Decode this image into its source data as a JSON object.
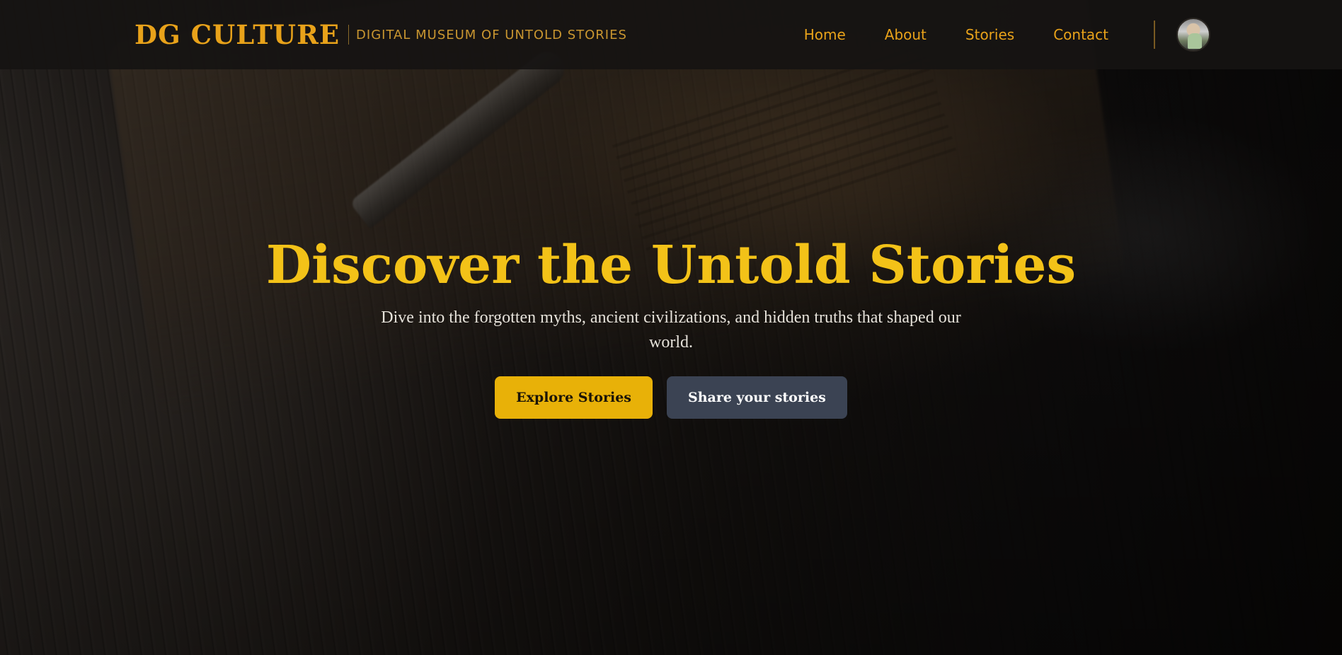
{
  "header": {
    "logo": "DG CULTURE",
    "tagline": "DIGITAL MUSEUM OF UNTOLD STORIES",
    "nav": [
      {
        "label": "Home"
      },
      {
        "label": "About"
      },
      {
        "label": "Stories"
      },
      {
        "label": "Contact"
      }
    ],
    "avatar_alt": "User avatar"
  },
  "hero": {
    "title": "Discover the Untold Stories",
    "subtitle": "Dive into the forgotten myths, ancient civilizations, and hidden truths that shaped our world.",
    "primary_cta": "Explore Stories",
    "secondary_cta": "Share your stories",
    "background": "old-book-and-fountain-pen-on-wooden-table"
  },
  "colors": {
    "accent": "#e8a21a",
    "title": "#f3c218",
    "primary_button": "#e8b108",
    "secondary_button": "#3b4353",
    "header_bg": "#161412"
  }
}
